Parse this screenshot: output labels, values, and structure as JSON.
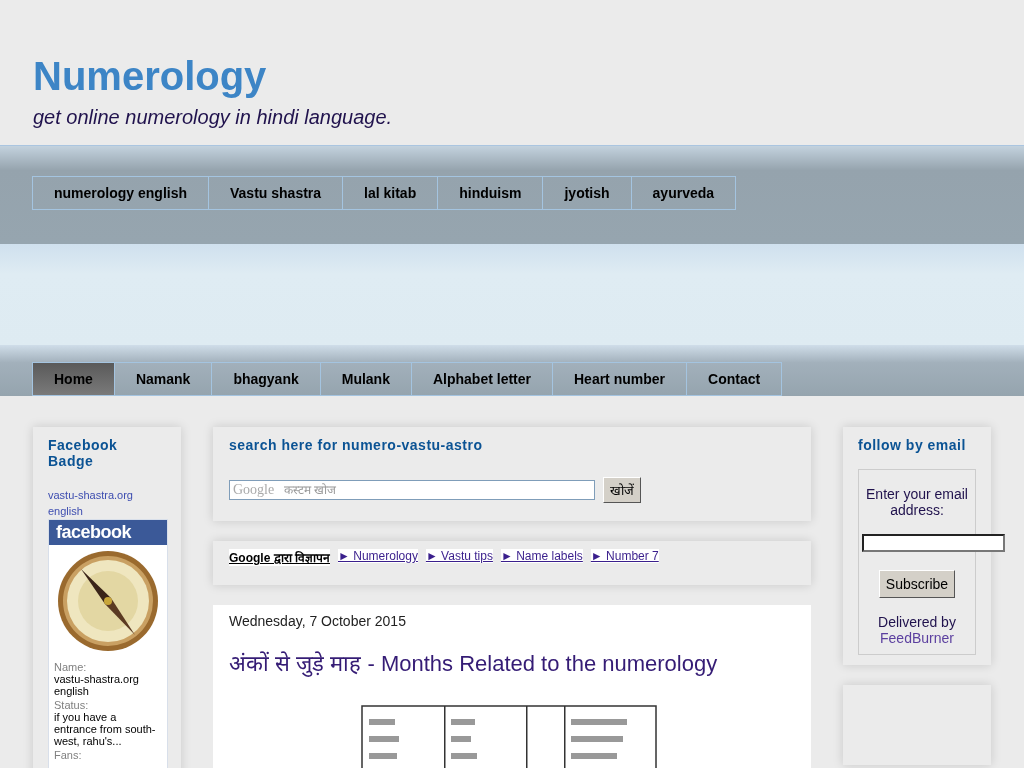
{
  "header": {
    "title": "Numerology",
    "tagline": "get online numerology in hindi language."
  },
  "top_nav": [
    "numerology english",
    "Vastu shastra",
    "lal kitab",
    "hinduism",
    "jyotish",
    "ayurveda"
  ],
  "main_nav": [
    {
      "label": "Home",
      "selected": true
    },
    {
      "label": "Namank",
      "selected": false
    },
    {
      "label": "bhagyank",
      "selected": false
    },
    {
      "label": "Mulank",
      "selected": false
    },
    {
      "label": "Alphabet letter",
      "selected": false
    },
    {
      "label": "Heart number",
      "selected": false
    },
    {
      "label": "Contact",
      "selected": false
    }
  ],
  "facebook_badge": {
    "title": "Facebook Badge",
    "link": "vastu-shastra.org english",
    "logo": "facebook",
    "fields": [
      {
        "label": "Name:",
        "value": "vastu-shastra.org english"
      },
      {
        "label": "Status:",
        "value": "if you have a entrance from south-west, rahu's..."
      },
      {
        "label": "Fans:"
      }
    ]
  },
  "search": {
    "title": "search here for numero-vastu-astro",
    "brand": "Google",
    "placeholder": "कस्टम खोज",
    "button": "खोजें"
  },
  "ads": {
    "label": "Google द्वारा विज्ञापन",
    "links": [
      "► Numerology",
      "► Vastu tips",
      "► Name labels",
      "► Number 7"
    ]
  },
  "post": {
    "date": "Wednesday, 7 October 2015",
    "title": "अंकों से जुडे़ माह - Months Related to the numerology"
  },
  "follow": {
    "title": "follow by email",
    "prompt": "Enter your email address:",
    "button": "Subscribe",
    "delivered": "Delivered by",
    "provider": "FeedBurner"
  }
}
